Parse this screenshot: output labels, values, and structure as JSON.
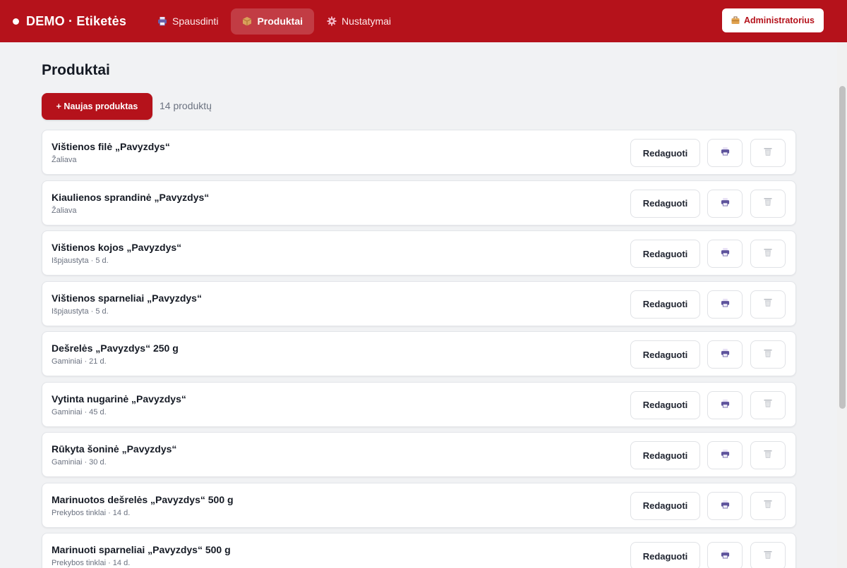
{
  "header": {
    "brand": "DEMO · Etiketės",
    "nav": [
      {
        "label": "Spausdinti",
        "icon": "printer-icon"
      },
      {
        "label": "Produktai",
        "icon": "package-icon"
      },
      {
        "label": "Nustatymai",
        "icon": "gear-icon"
      }
    ],
    "admin_label": "Administratorius",
    "colors": {
      "primary": "#b5121b"
    }
  },
  "main": {
    "title": "Produktai",
    "new_button": "+ Naujas produktas",
    "count": "14 produktų",
    "edit_label": "Redaguoti",
    "products": [
      {
        "name": "Vištienos filė „Pavyzdys“",
        "meta": "Žaliava"
      },
      {
        "name": "Kiaulienos sprandinė „Pavyzdys“",
        "meta": "Žaliava"
      },
      {
        "name": "Vištienos kojos „Pavyzdys“",
        "meta": "Išpjaustyta · 5 d."
      },
      {
        "name": "Vištienos sparneliai „Pavyzdys“",
        "meta": "Išpjaustyta · 5 d."
      },
      {
        "name": "Dešrelės „Pavyzdys“ 250 g",
        "meta": "Gaminiai · 21 d."
      },
      {
        "name": "Vytinta nugarinė „Pavyzdys“",
        "meta": "Gaminiai · 45 d."
      },
      {
        "name": "Rūkyta šoninė „Pavyzdys“",
        "meta": "Gaminiai · 30 d."
      },
      {
        "name": "Marinuotos dešrelės „Pavyzdys“ 500 g",
        "meta": "Prekybos tinklai · 14 d."
      },
      {
        "name": "Marinuoti sparneliai „Pavyzdys“ 500 g",
        "meta": "Prekybos tinklai · 14 d."
      }
    ]
  }
}
